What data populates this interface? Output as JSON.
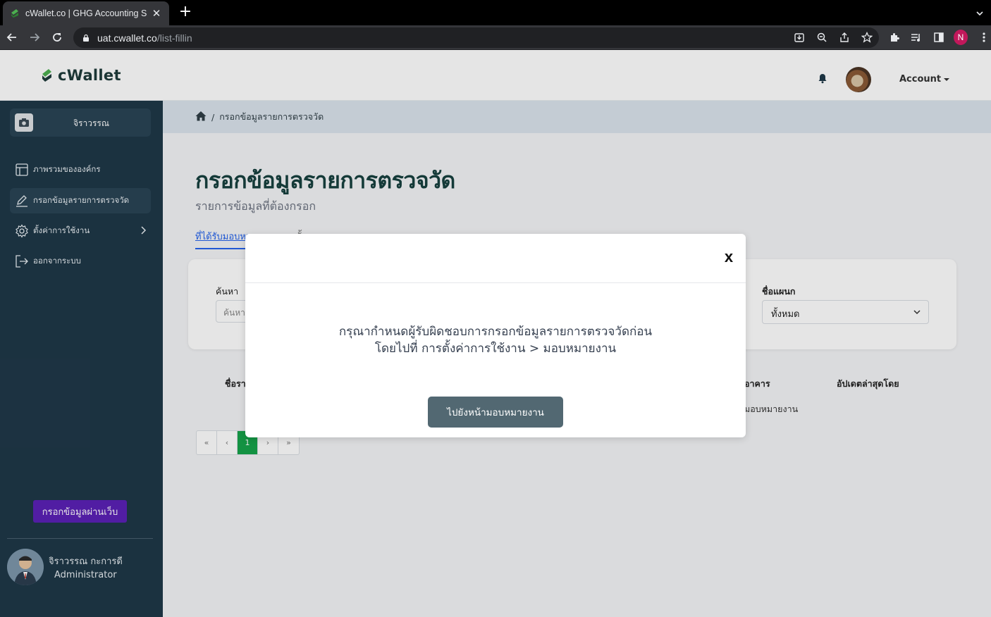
{
  "browser": {
    "tab_title": "cWallet.co | GHG Accounting S",
    "url_host": "uat.cwallet.co",
    "url_path": "/list-fillin",
    "profile_initial": "N"
  },
  "header": {
    "logo_text": "cWallet",
    "account_label": "Account"
  },
  "sidebar": {
    "org_name": "จิราวรรณ",
    "items": [
      {
        "label": "ภาพรวมขององค์กร",
        "icon": "layout-icon"
      },
      {
        "label": "กรอกข้อมูลรายการตรวจวัด",
        "icon": "pencil-icon"
      },
      {
        "label": "ตั้งค่าการใช้งาน",
        "icon": "gear-icon"
      },
      {
        "label": "ออกจากระบบ",
        "icon": "logout-icon"
      }
    ],
    "web_button": "กรอกข้อมูลผ่านเว็บ",
    "user_name": "จิราวรรณ กะการดี",
    "user_role": "Administrator"
  },
  "breadcrumb": {
    "current": "กรอกข้อมูลรายการตรวจวัด"
  },
  "main": {
    "title": "กรอกข้อมูลรายการตรวจวัด",
    "subtitle": "รายการข้อมูลที่ต้องกรอก",
    "tab_assigned": "ที่ได้รับมอบหมาย",
    "tab_all": "ทั้งหมด",
    "search_label": "ค้นหา",
    "search_placeholder": "ค้นหา",
    "dept_label": "ชื่อแผนก",
    "dept_value": "ทั้งหมด",
    "col_name": "ชื่อรายการ",
    "col_building": "อาคาร",
    "col_updated": "อัปเดตล่าสุดโดย",
    "row_text": "มอบหมายงาน",
    "pager": [
      "«",
      "‹",
      "1",
      "›",
      "»"
    ]
  },
  "modal": {
    "close_label": "x",
    "message_line1": "กรุณากำหนดผู้รับผิดชอบการกรอกข้อมูลรายการตรวจวัดก่อน",
    "message_line2": "โดยไปที่ การตั้งค่าการใช้งาน > มอบหมายงาน",
    "button_label": "ไปยังหน้ามอบหมายงาน"
  }
}
